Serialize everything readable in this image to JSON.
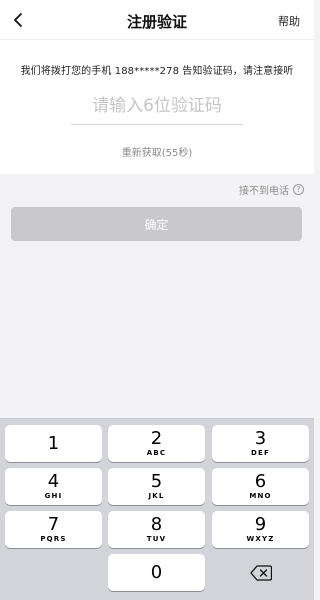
{
  "header": {
    "title": "注册验证",
    "help_label": "帮助",
    "back_icon": "chevron-left-icon"
  },
  "verification": {
    "notice": "我们将拨打您的手机 188*****278 告知验证码，请注意接听",
    "input_placeholder": "请输入6位验证码",
    "input_value": "",
    "resend_label": "重新获取(55秒)"
  },
  "no_call": {
    "label": "接不到电话",
    "icon": "question-circle-icon",
    "icon_glyph": "?"
  },
  "confirm_button": {
    "label": "确定",
    "color": "#c9c9cc"
  },
  "keyboard": {
    "keys": [
      {
        "digit": "1",
        "letters": ""
      },
      {
        "digit": "2",
        "letters": "ABC"
      },
      {
        "digit": "3",
        "letters": "DEF"
      },
      {
        "digit": "4",
        "letters": "GHI"
      },
      {
        "digit": "5",
        "letters": "JKL"
      },
      {
        "digit": "6",
        "letters": "MNO"
      },
      {
        "digit": "7",
        "letters": "PQRS"
      },
      {
        "digit": "8",
        "letters": "TUV"
      },
      {
        "digit": "9",
        "letters": "WXYZ"
      },
      {
        "digit": "0",
        "letters": ""
      }
    ],
    "delete_icon": "backspace-icon"
  }
}
